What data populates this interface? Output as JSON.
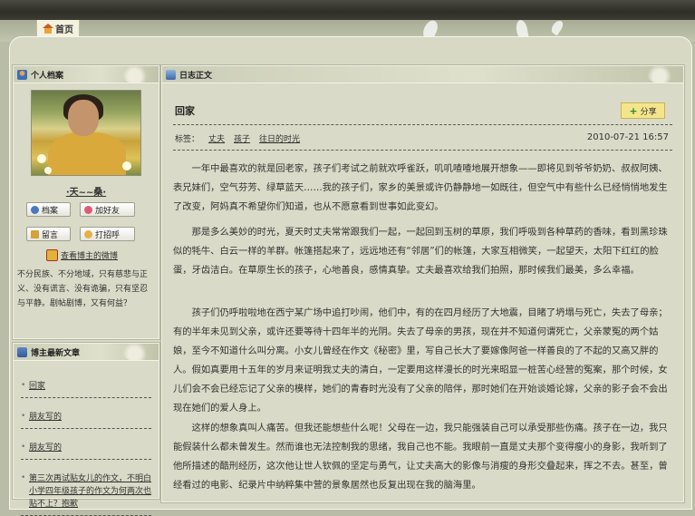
{
  "nav": {
    "home": "首页"
  },
  "profile": {
    "title": "个人档案",
    "name": "·天~~桑·",
    "buttons": {
      "archive": "档案",
      "add_friend": "加好友",
      "message": "留言",
      "greet": "打招呼"
    },
    "weibo": "查看博主的微博",
    "bio": "不分民族、不分地域，只有慈悲与正义、没有谎言、没有诡骗，只有坚忍与平静。剧帖剧博，又有何益？"
  },
  "recent": {
    "title": "博主最新文章",
    "items": [
      "回家",
      "朋友写的",
      "朋友写的",
      "第三次再试贴女儿的作文，不明白小学四年级孩子的作文为何两次也贴不上？抱歉"
    ]
  },
  "diary": {
    "section_title": "日志正文",
    "title": "回家",
    "share": "分享",
    "tags_label": "标签：",
    "tags": [
      "丈夫",
      "孩子",
      "往日的时光"
    ],
    "date": "2010-07-21 16:57",
    "paragraphs": [
      "一年中最喜欢的就是回老家，孩子们考试之前就欢呼雀跃，叽叽喳喳地展开想象——即将见到爷爷奶奶、叔叔阿姨、表兄妹们，空气芬芳、绿草蓝天……我的孩子们，家乡的美景或许仍静静地一如既往，但空气中有些什么已经悄悄地发生了改变，阿妈真不希望你们知道，也从不愿意看到世事如此变幻。",
      "那是多么美妙的时光，夏天时丈夫常常跟我们一起，一起回到玉树的草原，我们呼吸到各种草药的香味，看到黑珍珠似的牦牛、白云一样的羊群。帐篷搭起来了，远远地还有“邻居”们的帐篷，大家互相微笑，一起望天，太阳下红红的脸蛋，牙齿洁白。在草原生长的孩子，心地善良，感情真挚。丈夫最喜欢给我们拍照，那时候我们最美，多么幸福。",
      "孩子们仍呼啦啦地在西宁某广场中追打吵闹，他们中，有的在四月经历了大地震，目睹了坍塌与死亡，失去了母亲；有的半年未见到父亲，或许还要等待十四年半的光阴。失去了母亲的男孩，现在并不知道何谓死亡，父亲蒙冤的两个姑娘，至今不知道什么叫分离。小女儿曾经在作文《秘密》里，写自己长大了要嫁像阿爸一样善良的了不起的又高又胖的人。假如真要用十五年的岁月来证明我丈夫的清白，一定要用这样漫长的时光来昭显一桩苦心经营的冤案，那个时候，女儿们会不会已经忘记了父亲的模样，她们的青春时光没有了父亲的陪伴，那时她们在开始谈婚论嫁，父亲的影子会不会出现在她们的爱人身上。",
      "这样的想象真叫人痛苦。但我还能想些什么呢！父母在一边，我只能强装自己可以承受那些伤痛。孩子在一边，我只能假装什么都未曾发生。然而谁也无法控制我的思绪，我自己也不能。我眼前一直是丈夫那个变得瘦小的身影，我听到了他所描述的酷刑经历，这次他让世人钦佩的坚定与勇气，让丈夫高大的影像与消瘦的身形交叠起来，挥之不去。甚至，曾经看过的电影、纪录片中纳粹集中营的景象居然也反复出现在我的脑海里。"
    ]
  }
}
